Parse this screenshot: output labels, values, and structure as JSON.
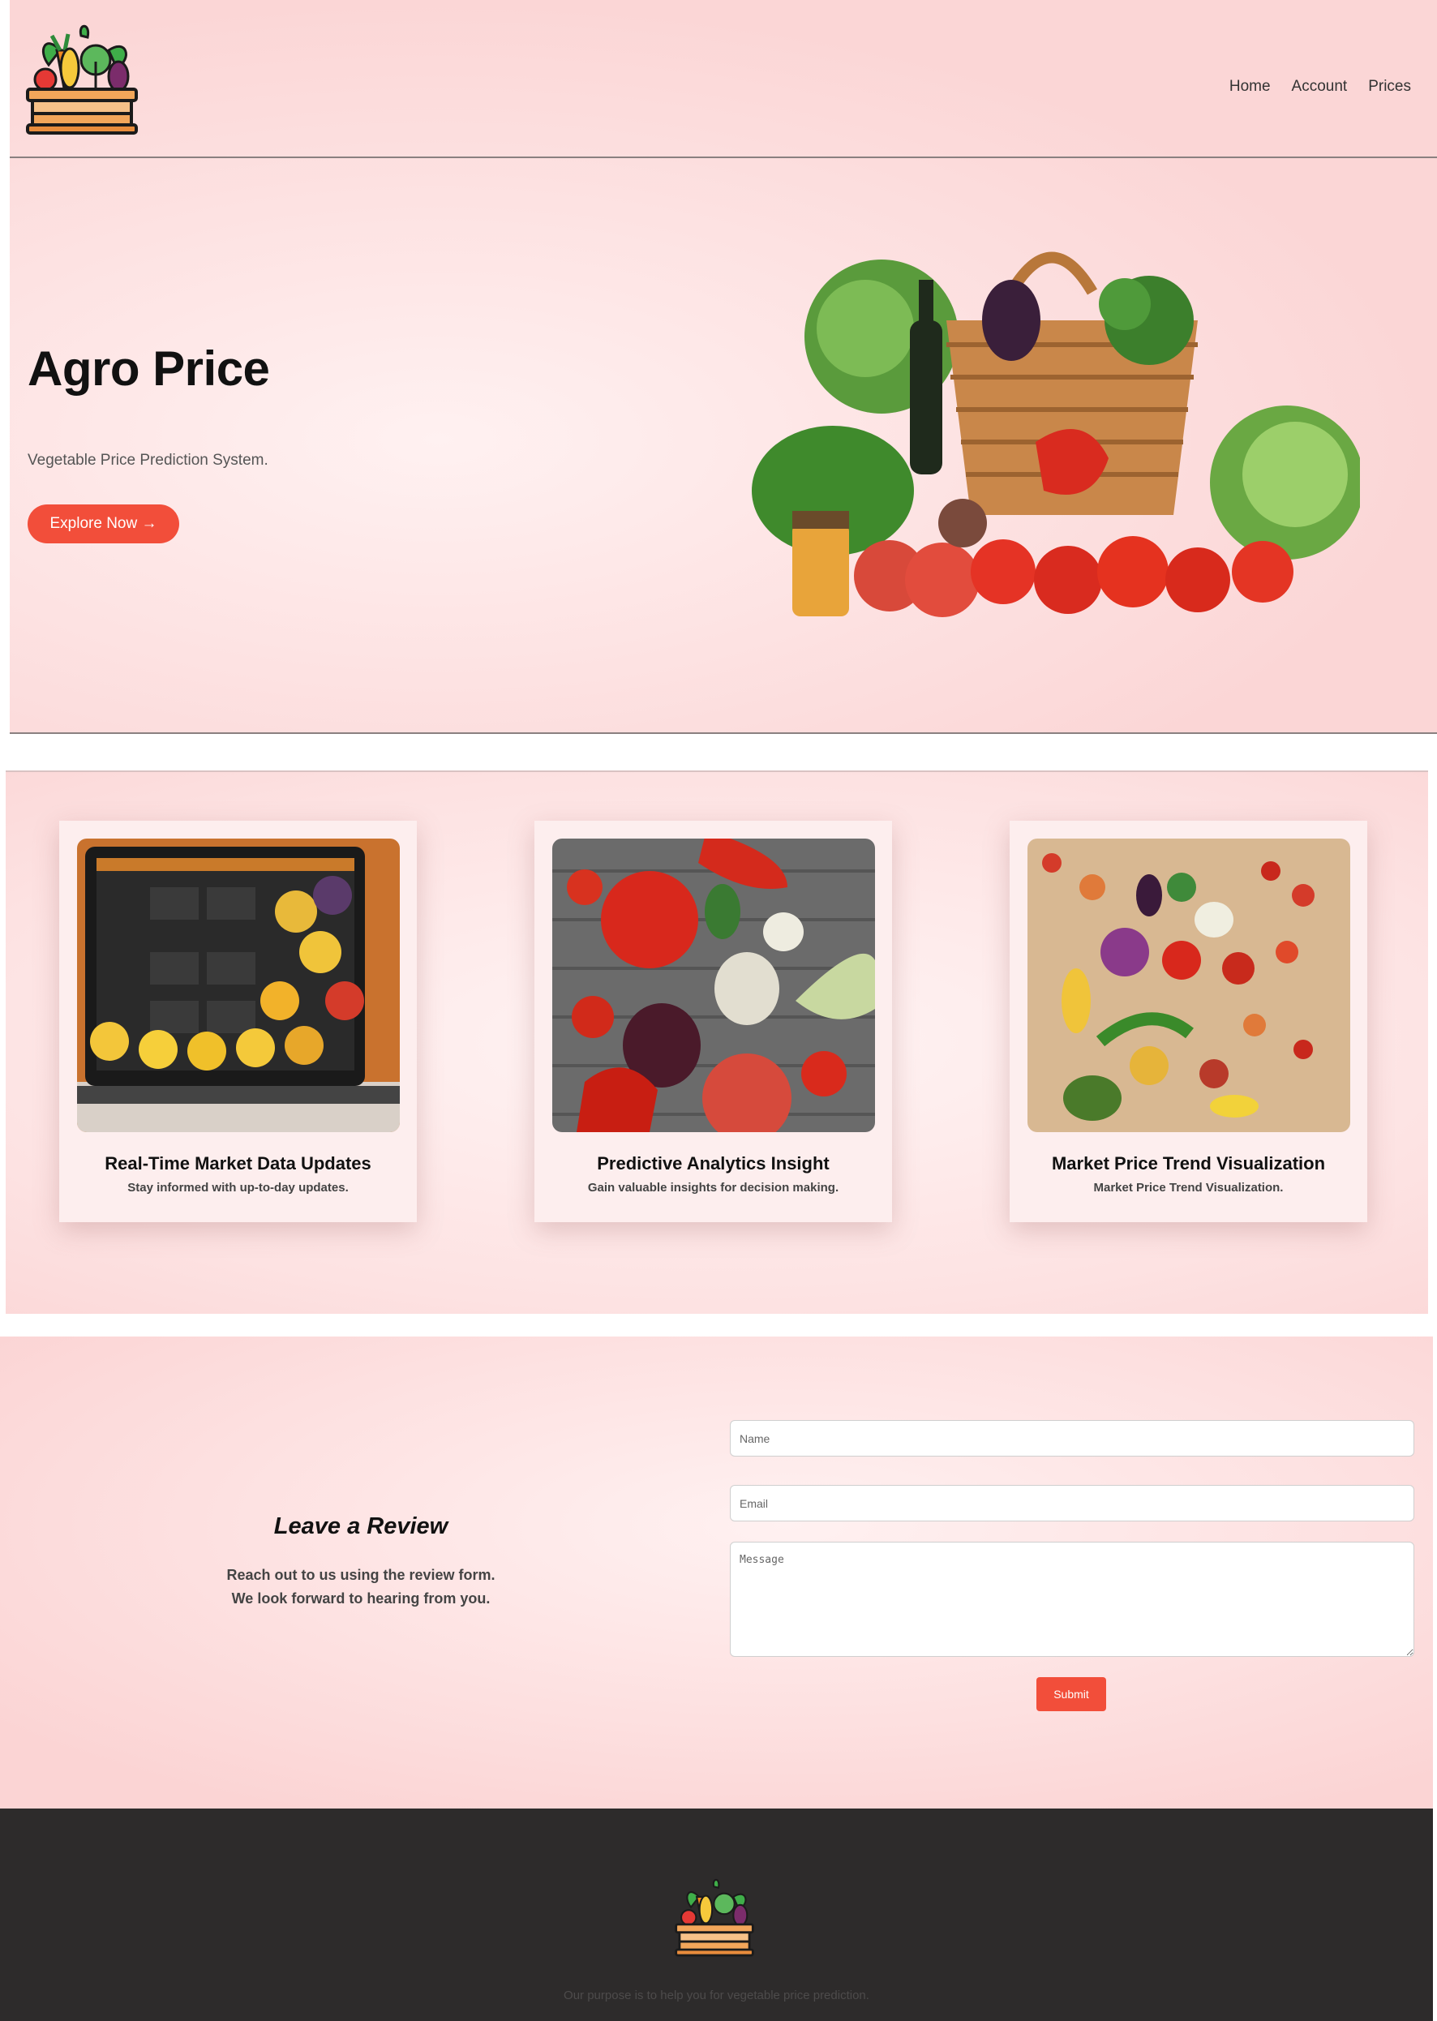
{
  "header": {
    "logo_icon": "vegetable-crate-logo",
    "nav": [
      {
        "label": "Home"
      },
      {
        "label": "Account"
      },
      {
        "label": "Prices"
      }
    ]
  },
  "hero": {
    "title": "Agro Price",
    "subtitle": "Vegetable Price Prediction System.",
    "cta_label": "Explore Now →",
    "image": "vegetable-basket-image"
  },
  "features": [
    {
      "title": "Real-Time Market Data Updates",
      "description": "Stay informed with up-to-day updates.",
      "image": "laptop-market-dashboard-image"
    },
    {
      "title": "Predictive Analytics Insight",
      "description": "Gain valuable insights for decision making.",
      "image": "tomatoes-on-wood-image"
    },
    {
      "title": "Market Price Trend Visualization",
      "description": "Market Price Trend Visualization.",
      "image": "vegetables-spread-image"
    }
  ],
  "review": {
    "title": "Leave a Review",
    "line1": "Reach out to us using the review form.",
    "line2": "We look forward to hearing from you.",
    "name_placeholder": "Name",
    "email_placeholder": "Email",
    "message_placeholder": "Message",
    "submit_label": "Submit"
  },
  "footer": {
    "logo_icon": "vegetable-crate-logo",
    "text": "Our purpose is to help you for vegetable price prediction."
  },
  "colors": {
    "accent": "#f24e3a",
    "background_pink": "#fde2e2",
    "footer_bg": "#2d2b2b"
  }
}
